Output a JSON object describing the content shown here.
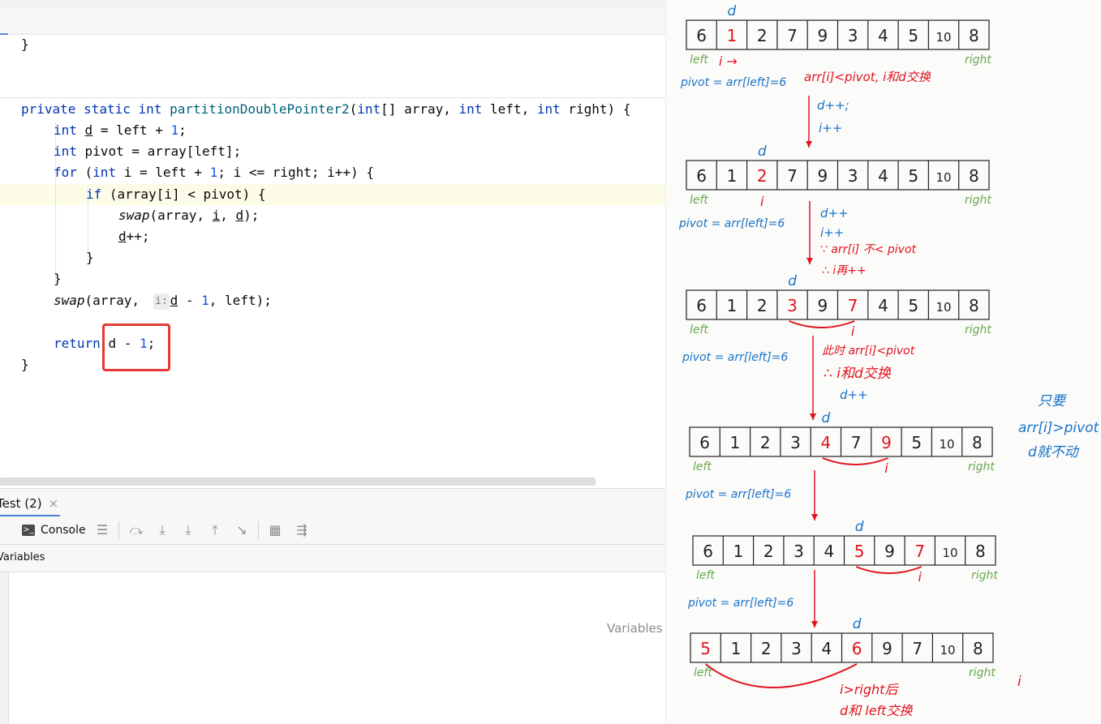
{
  "editor": {
    "top_line": "}",
    "signature": {
      "kw_private": "private",
      "kw_static": "static",
      "kw_int": "int",
      "method": "partitionDoublePointer2",
      "params_a": "(",
      "kw_int2": "int",
      "params_b": "[] array, ",
      "kw_int3": "int",
      "params_c": " left, ",
      "kw_int4": "int",
      "params_d": " right) {"
    },
    "line_d": {
      "kw": "int",
      "var": "d",
      "rest": " = left + ",
      "num": "1",
      "end": ";"
    },
    "line_pivot": {
      "kw": "int",
      "rest": " pivot = array[left];"
    },
    "line_for": {
      "kw": "for",
      "a": " (",
      "kw2": "int",
      "b": " i = left + ",
      "num": "1",
      "c": "; i <= right; i++) {"
    },
    "line_if": {
      "kw": "if",
      "rest": " (array[i] < pivot) {"
    },
    "line_swap": {
      "fn": "swap",
      "a": "(array, ",
      "i": "i",
      "b": ", ",
      "d": "d",
      "c": ");"
    },
    "line_dpp": {
      "d": "d",
      "rest": "++;"
    },
    "close_if": "}",
    "close_for": "}",
    "line_swap2": {
      "fn": "swap",
      "a": "(array, ",
      "hint": "i:",
      "d": "d",
      "b": " - ",
      "num": "1",
      "c": ", left);"
    },
    "line_return": {
      "kw": "return",
      "d": "d",
      "b": " - ",
      "num": "1",
      "c": ";"
    },
    "close_method": "}"
  },
  "debug": {
    "tab_label": "Test (2)",
    "tab_close": "×",
    "console_label": "Console",
    "variables_header": "Variables",
    "variables_empty": "Variables"
  },
  "notes": {
    "arrays": [
      {
        "cells": [
          "6",
          "1",
          "2",
          "7",
          "9",
          "3",
          "4",
          "5",
          "10",
          "8"
        ],
        "red": [
          1
        ]
      },
      {
        "cells": [
          "6",
          "1",
          "2",
          "7",
          "9",
          "3",
          "4",
          "5",
          "10",
          "8"
        ],
        "red": [
          2
        ]
      },
      {
        "cells": [
          "6",
          "1",
          "2",
          "3",
          "9",
          "7",
          "4",
          "5",
          "10",
          "8"
        ],
        "red": [
          3,
          5
        ]
      },
      {
        "cells": [
          "6",
          "1",
          "2",
          "3",
          "4",
          "7",
          "9",
          "5",
          "10",
          "8"
        ],
        "red": [
          4,
          6
        ]
      },
      {
        "cells": [
          "6",
          "1",
          "2",
          "3",
          "4",
          "5",
          "9",
          "7",
          "10",
          "8"
        ],
        "red": [
          5,
          7
        ]
      },
      {
        "cells": [
          "5",
          "1",
          "2",
          "3",
          "4",
          "6",
          "9",
          "7",
          "10",
          "8"
        ],
        "red": [
          0,
          5
        ]
      }
    ],
    "d_label": "d",
    "i_label": "i",
    "i_arrow_label": "i →",
    "left_label": "left",
    "right_label": "right",
    "pivot_label": "pivot = arr[left]=6",
    "step1": [
      "arr[i]<pivot, i和d交换"
    ],
    "step1_inc": [
      "d++;",
      "i++"
    ],
    "step2_blue": [
      "d++",
      "i++"
    ],
    "step2_red": [
      "∵ arr[i] 不< pivot",
      "∴ i再++"
    ],
    "step3_red": [
      "此时 arr[i]<pivot",
      "∴ i和d交换"
    ],
    "step3_blue": "d++",
    "final_red": [
      "i>right后",
      "d和 left交换"
    ],
    "side_note": [
      "只要",
      "arr[i]>pivot",
      "d就不动"
    ],
    "stray_i": "i",
    "colors": {
      "blue": "#1a73c8",
      "red": "#e0141e",
      "green": "#6aa84f",
      "ink": "#222222"
    }
  }
}
